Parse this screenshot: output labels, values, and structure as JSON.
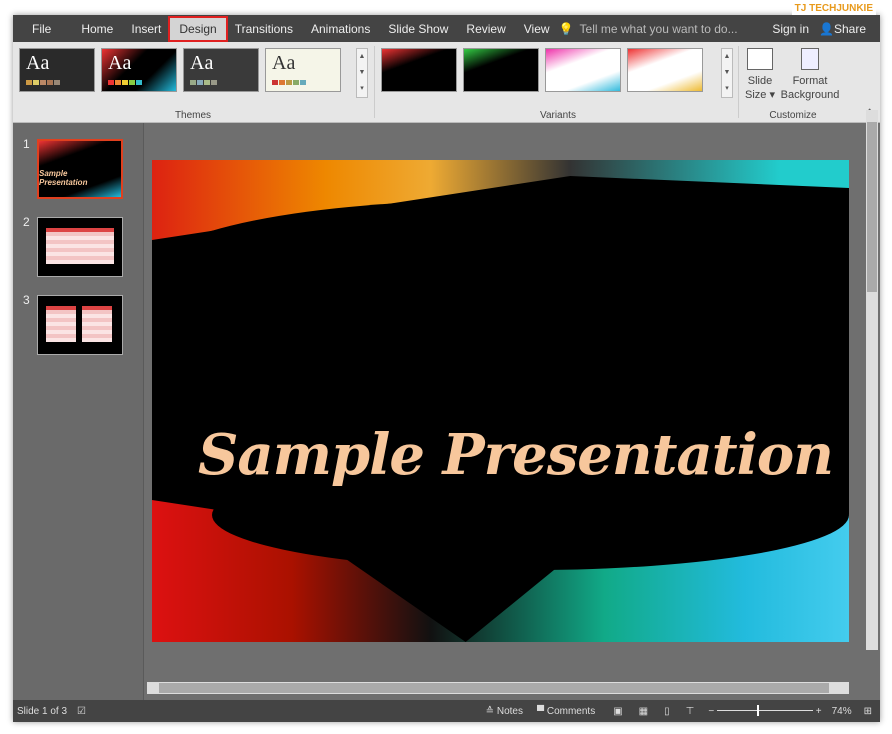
{
  "tabs": [
    "File",
    "Home",
    "Insert",
    "Design",
    "Transitions",
    "Animations",
    "Slide Show",
    "Review",
    "View"
  ],
  "selected_tab": "Design",
  "tell_me": "Tell me what you want to do...",
  "sign_in": "Sign in",
  "share": "Share",
  "watermark": "TECHJUNKIE",
  "themes": {
    "label": "Themes",
    "items": [
      "Aa",
      "Aa",
      "Aa",
      "Aa"
    ]
  },
  "variants": {
    "label": "Variants"
  },
  "customize": {
    "label": "Customize",
    "slide_size": "Slide Size",
    "format_background": "Format Background"
  },
  "slides": [
    "1",
    "2",
    "3"
  ],
  "slide_title": "Sample Presentation",
  "status": {
    "slide": "Slide 1 of 3",
    "notes": "Notes",
    "comments": "Comments",
    "zoom": "74%"
  }
}
